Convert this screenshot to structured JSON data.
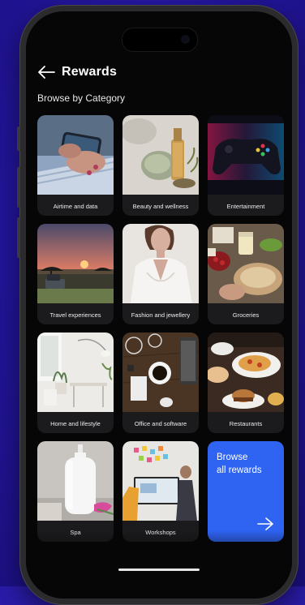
{
  "header": {
    "title": "Rewards",
    "back_icon": "arrow-left-icon"
  },
  "subtitle": "Browse by Category",
  "categories": [
    {
      "label": "Airtime and data",
      "image": "phone-in-hand"
    },
    {
      "label": "Beauty and wellness",
      "image": "perfume-and-stones"
    },
    {
      "label": "Entertainment",
      "image": "game-controller"
    },
    {
      "label": "Travel experiences",
      "image": "safari-sunset"
    },
    {
      "label": "Fashion and jewellery",
      "image": "woman-white-blouse"
    },
    {
      "label": "Groceries",
      "image": "food-table"
    },
    {
      "label": "Home and lifestyle",
      "image": "white-interior"
    },
    {
      "label": "Office and software",
      "image": "desk-with-coffee"
    },
    {
      "label": "Restaurants",
      "image": "restaurant-plates"
    },
    {
      "label": "Spa",
      "image": "spa-bottle"
    },
    {
      "label": "Workshops",
      "image": "office-workshop"
    }
  ],
  "cta": {
    "line1": "Browse",
    "line2": "all rewards",
    "arrow_icon": "arrow-right-icon",
    "color": "#2f63f2"
  },
  "colors": {
    "background": "#2a1ba8",
    "screen": "#060606",
    "tile": "#1b1b1d",
    "accent": "#2f63f2"
  }
}
